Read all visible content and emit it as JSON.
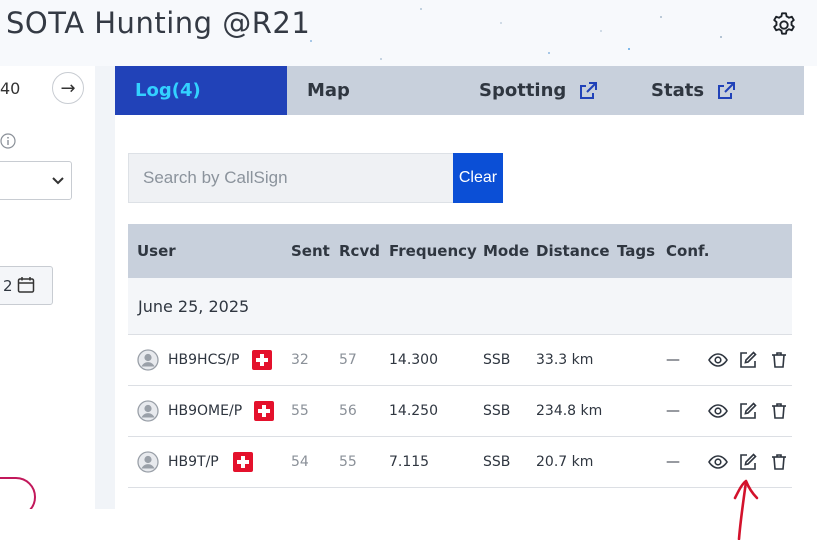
{
  "header": {
    "title": "SOTA Hunting @R21"
  },
  "left_panel": {
    "frequency_value": "40",
    "go_symbol": "→",
    "date_value": "2"
  },
  "tabs": [
    {
      "label": "Log(4)",
      "active": true,
      "external": false
    },
    {
      "label": "Map",
      "active": false,
      "external": false
    },
    {
      "label": "Spotting",
      "active": false,
      "external": true
    },
    {
      "label": "Stats",
      "active": false,
      "external": true
    }
  ],
  "search": {
    "placeholder": "Search by CallSign",
    "value": "",
    "clear_label": "Clear"
  },
  "table": {
    "columns": [
      "User",
      "Sent",
      "Rcvd",
      "Frequency",
      "Mode",
      "Distance",
      "Tags",
      "Conf."
    ],
    "date_group": "June 25, 2025",
    "rows": [
      {
        "callsign": "HB9HCS/P",
        "sent": "32",
        "rcvd": "57",
        "frequency": "14.300",
        "mode": "SSB",
        "distance": "33.3 km",
        "tags": "",
        "conf": "—"
      },
      {
        "callsign": "HB9OME/P",
        "sent": "55",
        "rcvd": "56",
        "frequency": "14.250",
        "mode": "SSB",
        "distance": "234.8 km",
        "tags": "",
        "conf": "—"
      },
      {
        "callsign": "HB9T/P",
        "sent": "54",
        "rcvd": "55",
        "frequency": "7.115",
        "mode": "SSB",
        "distance": "20.7 km",
        "tags": "",
        "conf": "—"
      }
    ]
  },
  "colors": {
    "tab_active_bg": "#2142b8",
    "tab_active_text": "#33d1ff",
    "clear_button": "#0b4fd6",
    "table_header_bg": "#c8d0dc",
    "annotation_arrow": "#d3122c",
    "flag_red": "#e4112c"
  },
  "icons": {
    "settings": "gear-icon",
    "view": "eye-icon",
    "edit": "edit-icon",
    "delete": "trash-icon",
    "external": "external-link-icon",
    "user": "user-avatar-icon",
    "flag": "swiss-flag-icon"
  }
}
